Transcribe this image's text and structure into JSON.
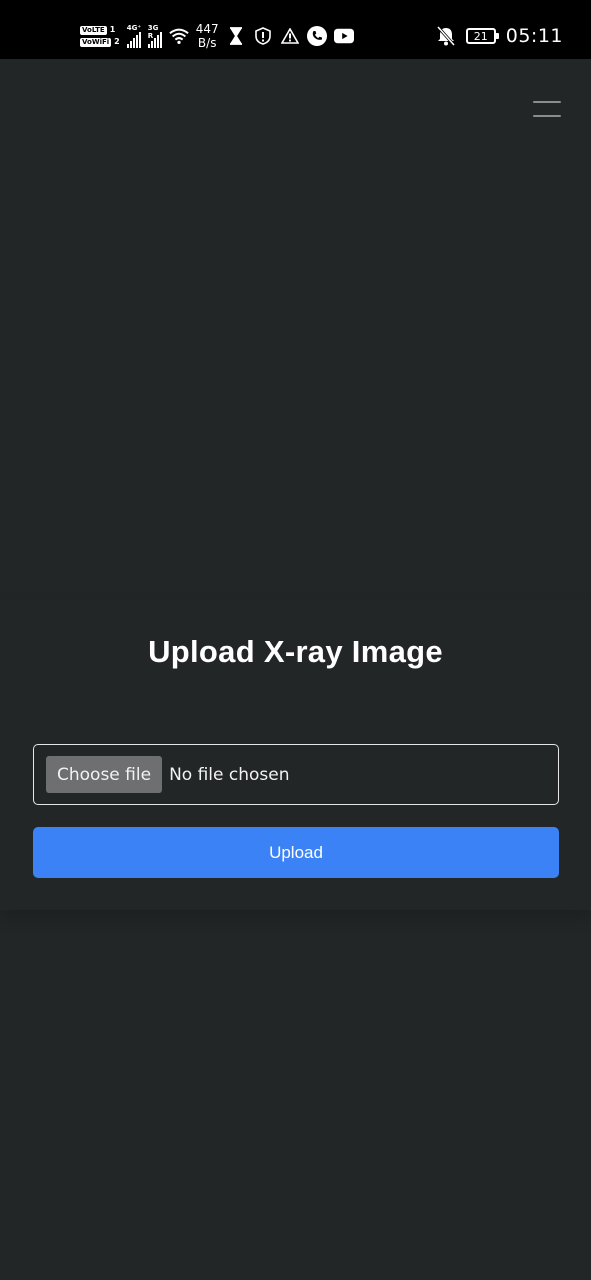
{
  "status_bar": {
    "sim1": "VoLTE",
    "sim1_num": "1",
    "sim2": "VoWiFi",
    "sim2_num": "2",
    "net1": "4G⁺",
    "net2": "3G R",
    "speed_value": "447",
    "speed_unit": "B/s",
    "battery": "21",
    "time": "05:11"
  },
  "menu": {
    "icon": "hamburger-menu-icon"
  },
  "upload_form": {
    "title": "Upload X-ray Image",
    "choose_file_label": "Choose file",
    "file_status": "No file chosen",
    "submit_label": "Upload"
  },
  "colors": {
    "background": "#232627",
    "accent": "#3b82f6",
    "file_button": "#6d6f70"
  }
}
